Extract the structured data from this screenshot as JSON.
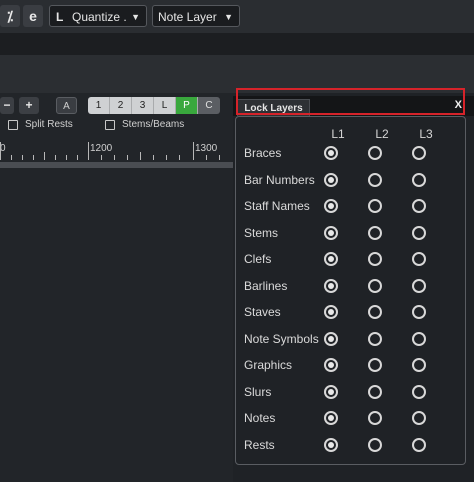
{
  "toolbar": {
    "icon1": "⁒",
    "icon2": "e",
    "quantize_icon": "L",
    "quantize_value": "Quantize .",
    "layer_value": "Note Layer"
  },
  "controls": {
    "minus": "−",
    "plus": "+",
    "a_button": "A",
    "segments": [
      "1",
      "2",
      "3",
      "L",
      "P",
      "C"
    ],
    "split_rests": "Split Rests",
    "stems_beams": "Stems/Beams"
  },
  "ruler": {
    "labels": [
      "0",
      "1200",
      "1300"
    ]
  },
  "lock_layers": {
    "title": "Lock Layers",
    "close": "X",
    "columns": [
      "L1",
      "L2",
      "L3"
    ],
    "rows": [
      {
        "label": "Braces",
        "selected": 0
      },
      {
        "label": "Bar Numbers",
        "selected": 0
      },
      {
        "label": "Staff Names",
        "selected": 0
      },
      {
        "label": "Stems",
        "selected": 0
      },
      {
        "label": "Clefs",
        "selected": 0
      },
      {
        "label": "Barlines",
        "selected": 0
      },
      {
        "label": "Staves",
        "selected": 0
      },
      {
        "label": "Note Symbols",
        "selected": 0
      },
      {
        "label": "Graphics",
        "selected": 0
      },
      {
        "label": "Slurs",
        "selected": 0
      },
      {
        "label": "Notes",
        "selected": 0
      },
      {
        "label": "Rests",
        "selected": 0
      }
    ]
  },
  "colors": {
    "accent_green": "#39a83d",
    "highlight_red": "#d6232a"
  }
}
